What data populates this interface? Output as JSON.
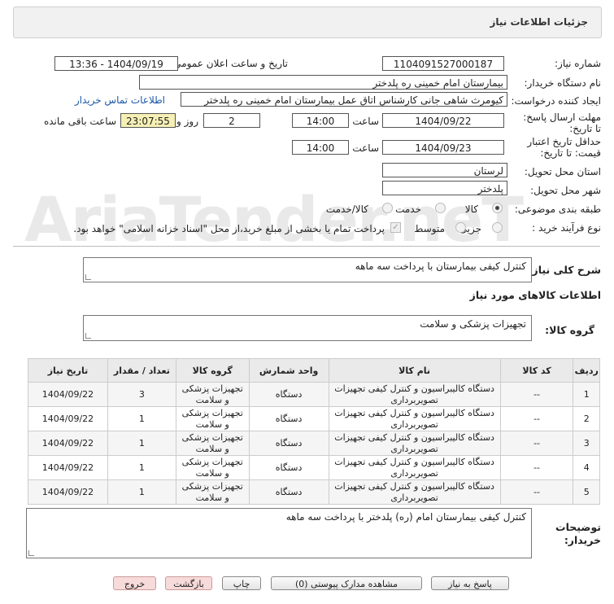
{
  "panel_title": "جزئیات اطلاعات نیاز",
  "watermark": "AriaTender.neT",
  "fields": {
    "need_number_label": "شماره نیاز:",
    "need_number": "1104091527000187",
    "announce_label": "تاریخ و ساعت اعلان عمومی:",
    "announce_value": "1404/09/19 - 13:36",
    "buyer_label": "نام دستگاه خریدار:",
    "buyer_value": "بیمارستان امام خمینی ره پلدختر",
    "creator_label": "ایجاد کننده درخواست:",
    "creator_value": "کیومرث شاهی جانی کارشناس اتاق عمل بیمارستان امام خمینی ره پلدختر",
    "contact_link": "اطلاعات تماس خریدار",
    "deadline_label": "مهلت ارسال پاسخ: تا تاریخ:",
    "deadline_date": "1404/09/22",
    "time_label": "ساعت",
    "deadline_time": "14:00",
    "days_value": "2",
    "days_label": "روز و",
    "remaining_value": "23:07:55",
    "remaining_label": "ساعت باقی مانده",
    "price_validity_label": "حداقل تاریخ اعتبار قیمت: تا تاریخ:",
    "price_validity_date": "1404/09/23",
    "price_validity_time": "14:00",
    "province_label": "استان محل تحویل:",
    "province_value": "لرستان",
    "city_label": "شهر محل تحویل:",
    "city_value": "پلدختر",
    "category_label": "طبقه بندی موضوعی:",
    "cat_goods": "کالا",
    "cat_service": "خدمت",
    "cat_goods_service": "کالا/خدمت",
    "process_label": "نوع فرآیند خرید :",
    "proc_partial": "جزیی",
    "proc_medium": "متوسط",
    "payment_note": "پرداخت تمام یا بخشی از مبلغ خرید،از محل \"اسناد خزانه اسلامی\" خواهد بود."
  },
  "summary": {
    "label": "شرح کلی نیاز:",
    "value": "کنترل کیفی بیمارستان با پرداخت سه ماهه"
  },
  "goods_info_title": "اطلاعات کالاهای مورد نیاز",
  "goods_group": {
    "label": "گروه کالا:",
    "value": "تجهیزات پزشکی و سلامت"
  },
  "table": {
    "headers": [
      "ردیف",
      "کد کالا",
      "نام کالا",
      "واحد شمارش",
      "گروه کالا",
      "تعداد / مقدار",
      "تاریخ نیاز"
    ],
    "rows": [
      [
        "1",
        "--",
        "دستگاه کالیبراسیون و کنترل کیفی تجهیزات تصویربرداری",
        "دستگاه",
        "تجهیزات پزشکی و سلامت",
        "3",
        "1404/09/22"
      ],
      [
        "2",
        "--",
        "دستگاه کالیبراسیون و کنترل کیفی تجهیزات تصویربرداری",
        "دستگاه",
        "تجهیزات پزشکی و سلامت",
        "1",
        "1404/09/22"
      ],
      [
        "3",
        "--",
        "دستگاه کالیبراسیون و کنترل کیفی تجهیزات تصویربرداری",
        "دستگاه",
        "تجهیزات پزشکی و سلامت",
        "1",
        "1404/09/22"
      ],
      [
        "4",
        "--",
        "دستگاه کالیبراسیون و کنترل کیفی تجهیزات تصویربرداری",
        "دستگاه",
        "تجهیزات پزشکی و سلامت",
        "1",
        "1404/09/22"
      ],
      [
        "5",
        "--",
        "دستگاه کالیبراسیون و کنترل کیفی تجهیزات تصویربرداری",
        "دستگاه",
        "تجهیزات پزشکی و سلامت",
        "1",
        "1404/09/22"
      ]
    ]
  },
  "buyer_notes": {
    "label": "توضیحات خریدار:",
    "value": "کنترل کیفی بیمارستان امام (ره) پلدختر با پرداخت سه ماهه"
  },
  "buttons": {
    "reply": "پاسخ به نیاز",
    "attachments": "مشاهده مدارک پیوستی (0)",
    "print": "چاپ",
    "back": "بازگشت",
    "exit": "خروج"
  }
}
